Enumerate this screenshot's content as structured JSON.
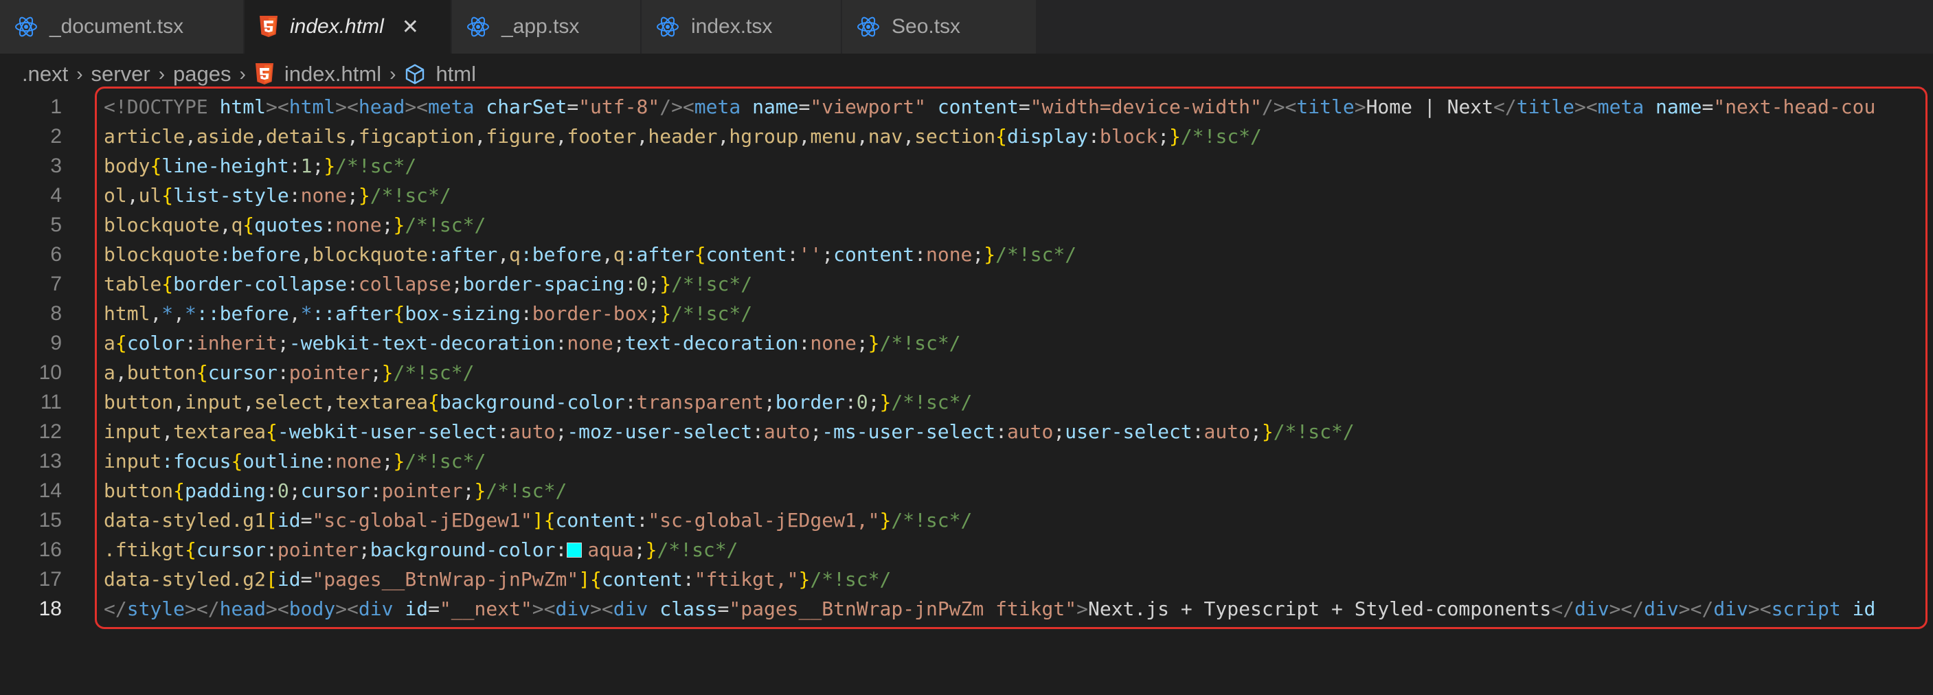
{
  "tabs": [
    {
      "label": "_document.tsx",
      "icon": "react-icon",
      "active": false
    },
    {
      "label": "index.html",
      "icon": "html5-icon",
      "active": true
    },
    {
      "label": "_app.tsx",
      "icon": "react-icon",
      "active": false
    },
    {
      "label": "index.tsx",
      "icon": "react-icon",
      "active": false
    },
    {
      "label": "Seo.tsx",
      "icon": "react-icon",
      "active": false
    }
  ],
  "tab_close_glyph": "✕",
  "breadcrumb": {
    "items": [
      ".next",
      "server",
      "pages",
      "index.html",
      "html"
    ],
    "separator": "›"
  },
  "colors": {
    "background": "#1e1e1e",
    "tabbar": "#252526",
    "react": "#3794ff",
    "html5": "#e44d26",
    "highlight_border": "#e0312b",
    "swatch_aqua": "#00ffff"
  },
  "editor": {
    "line_numbers": [
      "1",
      "2",
      "3",
      "4",
      "5",
      "6",
      "7",
      "8",
      "9",
      "10",
      "11",
      "12",
      "13",
      "14",
      "15",
      "16",
      "17",
      "18"
    ],
    "current_line": "18",
    "line1": {
      "a": "<!DOCTYPE",
      "b": " html",
      "c": "><",
      "d": "html",
      "e": "><",
      "f": "head",
      "g": "><",
      "h": "meta",
      "i": " charSet",
      "j": "=",
      "k": "\"utf-8\"",
      "l": "/><",
      "m": "meta",
      "n": " name",
      "o": "=",
      "p": "\"viewport\"",
      "q": " content",
      "r": "=",
      "s": "\"width=device-width\"",
      "t": "/><",
      "u": "title",
      "v": ">",
      "w": "Home | Next",
      "x": "</",
      "y": "title",
      "z": "><",
      "aa": "meta",
      "ab": " name",
      "ac": "=",
      "ad": "\"next-head-cou"
    },
    "line2": {
      "a": "article",
      "b": ",",
      "c": "aside",
      "d": ",",
      "e": "details",
      "f": ",",
      "g": "figcaption",
      "h": ",",
      "i": "figure",
      "j": ",",
      "k": "footer",
      "l": ",",
      "m": "header",
      "n": ",",
      "o": "hgroup",
      "p": ",",
      "q": "menu",
      "r": ",",
      "s": "nav",
      "t": ",",
      "u": "section",
      "v": "{",
      "w": "display",
      "x": ":",
      "y": "block",
      "z": ";",
      "aa": "}",
      "ab": "/*!sc*/"
    },
    "line3": {
      "a": "body",
      "b": "{",
      "c": "line-height",
      "d": ":",
      "e": "1",
      "f": ";",
      "g": "}",
      "h": "/*!sc*/"
    },
    "line4": {
      "a": "ol",
      "b": ",",
      "c": "ul",
      "d": "{",
      "e": "list-style",
      "f": ":",
      "g": "none",
      "h": ";",
      "i": "}",
      "j": "/*!sc*/"
    },
    "line5": {
      "a": "blockquote",
      "b": ",",
      "c": "q",
      "d": "{",
      "e": "quotes",
      "f": ":",
      "g": "none",
      "h": ";",
      "i": "}",
      "j": "/*!sc*/"
    },
    "line6": {
      "a": "blockquote",
      "b": ":before",
      "c": ",",
      "d": "blockquote",
      "e": ":after",
      "f": ",",
      "g": "q",
      "h": ":before",
      "i": ",",
      "j": "q",
      "k": ":after",
      "l": "{",
      "m": "content",
      "n": ":",
      "o": "''",
      "p": ";",
      "q": "content",
      "r": ":",
      "s": "none",
      "t": ";",
      "u": "}",
      "v": "/*!sc*/"
    },
    "line7": {
      "a": "table",
      "b": "{",
      "c": "border-collapse",
      "d": ":",
      "e": "collapse",
      "f": ";",
      "g": "border-spacing",
      "h": ":",
      "i": "0",
      "j": ";",
      "k": "}",
      "l": "/*!sc*/"
    },
    "line8": {
      "a": "html",
      "b": ",",
      "c": "*",
      "d": ",",
      "e": "*",
      "f": "::before",
      "g": ",",
      "h": "*",
      "i": "::after",
      "j": "{",
      "k": "box-sizing",
      "l": ":",
      "m": "border-box",
      "n": ";",
      "o": "}",
      "p": "/*!sc*/"
    },
    "line9": {
      "a": "a",
      "b": "{",
      "c": "color",
      "d": ":",
      "e": "inherit",
      "f": ";",
      "g": "-webkit-text-decoration",
      "h": ":",
      "i": "none",
      "j": ";",
      "k": "text-decoration",
      "l": ":",
      "m": "none",
      "n": ";",
      "o": "}",
      "p": "/*!sc*/"
    },
    "line10": {
      "a": "a",
      "b": ",",
      "c": "button",
      "d": "{",
      "e": "cursor",
      "f": ":",
      "g": "pointer",
      "h": ";",
      "i": "}",
      "j": "/*!sc*/"
    },
    "line11": {
      "a": "button",
      "b": ",",
      "c": "input",
      "d": ",",
      "e": "select",
      "f": ",",
      "g": "textarea",
      "h": "{",
      "i": "background-color",
      "j": ":",
      "k": "transparent",
      "l": ";",
      "m": "border",
      "n": ":",
      "o": "0",
      "p": ";",
      "q": "}",
      "r": "/*!sc*/"
    },
    "line12": {
      "a": "input",
      "b": ",",
      "c": "textarea",
      "d": "{",
      "e": "-webkit-user-select",
      "f": ":",
      "g": "auto",
      "h": ";",
      "i": "-moz-user-select",
      "j": ":",
      "k": "auto",
      "l": ";",
      "m": "-ms-user-select",
      "n": ":",
      "o": "auto",
      "p": ";",
      "q": "user-select",
      "r": ":",
      "s": "auto",
      "t": ";",
      "u": "}",
      "v": "/*!sc*/"
    },
    "line13": {
      "a": "input",
      "b": ":focus",
      "c": "{",
      "d": "outline",
      "e": ":",
      "f": "none",
      "g": ";",
      "h": "}",
      "i": "/*!sc*/"
    },
    "line14": {
      "a": "button",
      "b": "{",
      "c": "padding",
      "d": ":",
      "e": "0",
      "f": ";",
      "g": "cursor",
      "h": ":",
      "i": "pointer",
      "j": ";",
      "k": "}",
      "l": "/*!sc*/"
    },
    "line15": {
      "a": "data-styled",
      "b": ".g1",
      "c": "[",
      "d": "id",
      "e": "=",
      "f": "\"sc-global-jEDgew1\"",
      "g": "]",
      "h": "{",
      "i": "content",
      "j": ":",
      "k": "\"sc-global-jEDgew1,\"",
      "l": "}",
      "m": "/*!sc*/"
    },
    "line16": {
      "a": ".ftikgt",
      "b": "{",
      "c": "cursor",
      "d": ":",
      "e": "pointer",
      "f": ";",
      "g": "background-color",
      "h": ":",
      "i": "aqua",
      "j": ";",
      "k": "}",
      "l": "/*!sc*/"
    },
    "line17": {
      "a": "data-styled",
      "b": ".g2",
      "c": "[",
      "d": "id",
      "e": "=",
      "f": "\"pages__BtnWrap-jnPwZm\"",
      "g": "]",
      "h": "{",
      "i": "content",
      "j": ":",
      "k": "\"ftikgt,\"",
      "l": "}",
      "m": "/*!sc*/"
    },
    "line18": {
      "a": "</",
      "b": "style",
      "c": "></",
      "d": "head",
      "e": "><",
      "f": "body",
      "g": "><",
      "h": "div",
      "i": " id",
      "j": "=",
      "k": "\"__next\"",
      "l": "><",
      "m": "div",
      "n": "><",
      "o": "div",
      "p": " class",
      "q": "=",
      "r": "\"pages__BtnWrap-jnPwZm ftikgt\"",
      "s": ">",
      "t": "Next.js + Typescript + Styled-components",
      "u": "</",
      "v": "div",
      "w": "></",
      "x": "div",
      "y": "></",
      "z": "div",
      "aa": "><",
      "ab": "script",
      "ac": " id"
    }
  }
}
